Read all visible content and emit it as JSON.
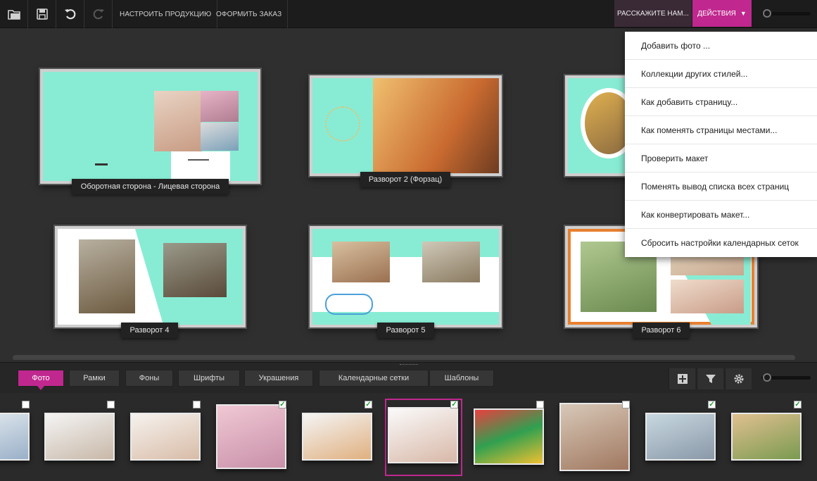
{
  "toolbar": {
    "customize_label": "НАСТРОИТЬ ПРОДУКЦИЮ",
    "order_label": "ОФОРМИТЬ ЗАКАЗ",
    "tell_label": "РАССКАЖИТЕ НАМ...",
    "actions_label": "ДЕЙСТВИЯ",
    "actions_arrow": "▼",
    "icons": [
      "folder-icon",
      "save-icon",
      "undo-icon",
      "redo-icon"
    ]
  },
  "colors": {
    "accent": "#c0288f",
    "mint": "#88ecd4",
    "toolbar_bg": "#1c1c1c"
  },
  "spreads": [
    {
      "label": "Оборотная сторона - Лицевая сторона"
    },
    {
      "label": "Разворот 2 (Форзац)"
    },
    {
      "label": ""
    },
    {
      "label": "Разворот 4"
    },
    {
      "label": "Разворот 5"
    },
    {
      "label": "Разворот 6"
    }
  ],
  "menu": {
    "items": [
      "Добавить фото ...",
      "Коллекции других стилей...",
      "Как добавить страницу...",
      "Как поменять страницы местами...",
      "Проверить макет",
      "Поменять вывод списка всех страниц",
      "Как конвертировать макет...",
      "Сбросить настройки календарных сеток"
    ]
  },
  "tabs": [
    "Фото",
    "Рамки",
    "Фоны",
    "Шрифты",
    "Украшения",
    "Календарные сетки",
    "Шаблоны"
  ],
  "active_tab": "Фото",
  "panel_icons": [
    "add-icon",
    "filter-icon",
    "settings-icon"
  ],
  "photos": [
    {
      "checked": false
    },
    {
      "checked": false
    },
    {
      "checked": false
    },
    {
      "checked": true
    },
    {
      "checked": true
    },
    {
      "checked": true,
      "selected": true
    },
    {
      "checked": false
    },
    {
      "checked": false
    },
    {
      "checked": true
    },
    {
      "checked": true
    }
  ]
}
